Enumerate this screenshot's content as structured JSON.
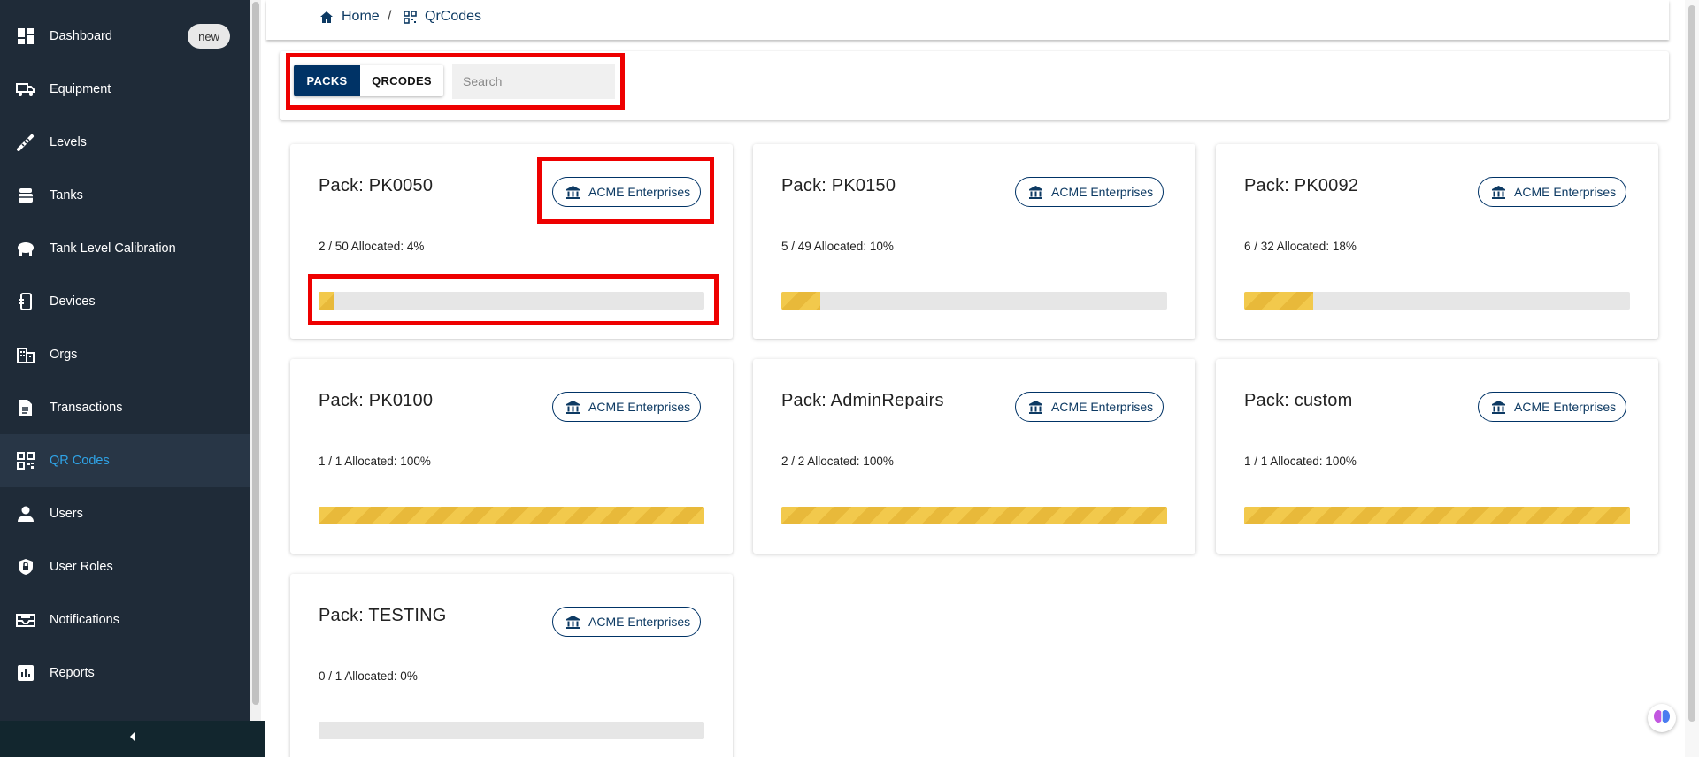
{
  "sidebar": {
    "items": [
      {
        "label": "Dashboard",
        "icon": "dashboard-icon",
        "badge": "new"
      },
      {
        "label": "Equipment",
        "icon": "truck-icon"
      },
      {
        "label": "Levels",
        "icon": "dipstick-icon"
      },
      {
        "label": "Tanks",
        "icon": "tank-icon"
      },
      {
        "label": "Tank Level Calibration",
        "icon": "calibration-icon"
      },
      {
        "label": "Devices",
        "icon": "device-icon"
      },
      {
        "label": "Orgs",
        "icon": "building-icon"
      },
      {
        "label": "Transactions",
        "icon": "document-icon"
      },
      {
        "label": "QR Codes",
        "icon": "qr-code-icon",
        "active": true
      },
      {
        "label": "Users",
        "icon": "user-icon"
      },
      {
        "label": "User Roles",
        "icon": "shield-icon"
      },
      {
        "label": "Notifications",
        "icon": "inbox-icon"
      },
      {
        "label": "Reports",
        "icon": "bar-chart-icon"
      }
    ],
    "collapse_icon": "chevron-left-icon"
  },
  "breadcrumb": {
    "home": "Home",
    "separator": "/",
    "current": "QrCodes"
  },
  "toolbar": {
    "tab_packs": "PACKS",
    "tab_qrcodes": "QRCODES",
    "active_tab": "PACKS",
    "search_placeholder": "Search",
    "search_value": ""
  },
  "packs": [
    {
      "title": "Pack: PK0050",
      "org": "ACME Enterprises",
      "allocation": "2 / 50 Allocated: 4%",
      "allocated": 2,
      "total": 50,
      "percent": 4
    },
    {
      "title": "Pack: PK0150",
      "org": "ACME Enterprises",
      "allocation": "5 / 49 Allocated: 10%",
      "allocated": 5,
      "total": 49,
      "percent": 10
    },
    {
      "title": "Pack: PK0092",
      "org": "ACME Enterprises",
      "allocation": "6 / 32 Allocated: 18%",
      "allocated": 6,
      "total": 32,
      "percent": 18
    },
    {
      "title": "Pack: PK0100",
      "org": "ACME Enterprises",
      "allocation": "1 / 1 Allocated: 100%",
      "allocated": 1,
      "total": 1,
      "percent": 100
    },
    {
      "title": "Pack: AdminRepairs",
      "org": "ACME Enterprises",
      "allocation": "2 / 2 Allocated: 100%",
      "allocated": 2,
      "total": 2,
      "percent": 100
    },
    {
      "title": "Pack: custom",
      "org": "ACME Enterprises",
      "allocation": "1 / 1 Allocated: 100%",
      "allocated": 1,
      "total": 1,
      "percent": 100
    },
    {
      "title": "Pack: TESTING",
      "org": "ACME Enterprises",
      "allocation": "0 / 1 Allocated: 0%",
      "allocated": 0,
      "total": 1,
      "percent": 0
    }
  ],
  "colors": {
    "sidebar_bg": "#1f2b38",
    "active_text": "#2fa3e6",
    "primary": "#003366",
    "progress": "#f2c94c",
    "highlight": "#ee0000"
  }
}
